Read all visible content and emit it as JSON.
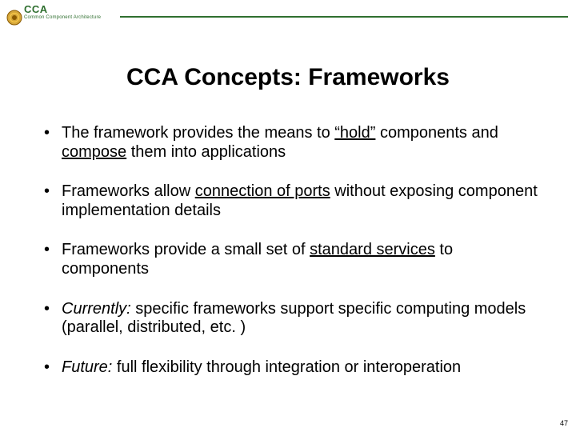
{
  "header": {
    "acronym": "CCA",
    "subtitle": "Common Component Architecture"
  },
  "title": "CCA Concepts: Frameworks",
  "bullets": [
    {
      "pre": "The framework provides the means to ",
      "em": "“hold”",
      "mid": " components and ",
      "em2": "compose",
      "post": " them into applications"
    },
    {
      "pre": "Frameworks allow ",
      "em": "connection of ports",
      "mid": "",
      "em2": "",
      "post": " without exposing component implementation details"
    },
    {
      "pre": "Frameworks provide a small set of ",
      "em": "standard services",
      "mid": "",
      "em2": "",
      "post": " to components"
    },
    {
      "lead_italic": "Currently:",
      "rest": " specific frameworks support specific computing models (parallel, distributed, etc. )"
    },
    {
      "lead_italic": "Future:",
      "rest": " full flexibility through integration or interoperation"
    }
  ],
  "page_number": "47"
}
